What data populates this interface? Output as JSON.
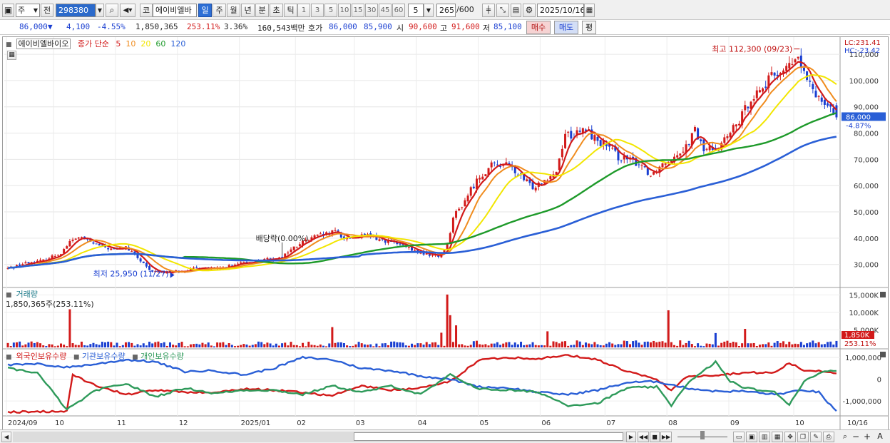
{
  "toolbar": {
    "period_unit": "주",
    "prev_label": "전",
    "stock_code": "298380",
    "market_badge": "코",
    "stock_name": "에이비엘바",
    "periods": [
      "일",
      "주",
      "월",
      "년",
      "분",
      "초",
      "틱"
    ],
    "active_period": "일",
    "intervals": [
      "1",
      "3",
      "5",
      "10",
      "15",
      "30",
      "45",
      "60"
    ],
    "interval_custom": "5",
    "count_value": "265",
    "count_max": "/600",
    "date_value": "2025/10/16"
  },
  "quote": {
    "price": "86,000",
    "change_arrow": "▼",
    "change": "4,100",
    "change_pct": "-4.55%",
    "volume": "1,850,365",
    "volume_ratio": "253.11%",
    "turnover": "3.36%",
    "amount": "160,543백만",
    "ask_label": "호가",
    "ask": "86,000",
    "bid": "85,900",
    "open_label": "시",
    "open": "90,600",
    "high_label": "고",
    "high": "91,600",
    "low_label": "저",
    "low": "85,100",
    "buy_label": "매수",
    "sell_label": "매도",
    "avg_label": "평"
  },
  "price_panel": {
    "stock_name": "에이비엘바이오",
    "ma_title": "종가 단순",
    "ma_periods": [
      "5",
      "10",
      "20",
      "60",
      "120"
    ],
    "lc": "LC:231.41",
    "hc": "HC:-23.42",
    "last_price_tag": "86,000",
    "last_pct_tag": "-4.87%",
    "high_note": "최고 112,300 (09/23)",
    "low_note": "최저 25,950 (11/27)",
    "dividend_note": "배당락(0.00%)"
  },
  "volume_panel": {
    "title": "거래량",
    "value_note": "1,850,365주(253.11%)",
    "last_tag": "1,850K",
    "last_pct": "253.11%"
  },
  "holding_panel": {
    "series": [
      "외국인보유수량",
      "기관보유수량",
      "개인보유수량"
    ]
  },
  "xaxis": {
    "labels": [
      "2024/09",
      "10",
      "11",
      "12",
      "2025/01",
      "02",
      "03",
      "04",
      "05",
      "06",
      "07",
      "08",
      "09",
      "10",
      "10/16"
    ]
  },
  "colors": {
    "up": "#d21a1a",
    "down": "#1a3fd1",
    "ma5": "#d21a1a",
    "ma10": "#f08c1e",
    "ma20": "#f2e600",
    "ma60": "#1e9a2a",
    "ma120": "#2a5fd6",
    "foreign": "#d21a1a",
    "institution": "#2a5fd6",
    "individual": "#2e9a5a"
  },
  "chart_data": [
    {
      "type": "candlestick",
      "title": "에이비엘바이오",
      "yticks": [
        30000,
        40000,
        50000,
        60000,
        70000,
        80000,
        90000,
        100000,
        110000
      ],
      "yticklabels": [
        "30,000",
        "40,000",
        "50,000",
        "60,000",
        "70,000",
        "80,000",
        "90,000",
        "100,000",
        "110,000"
      ],
      "ylim": [
        21500,
        116000
      ],
      "grid": true,
      "close_anchors": [
        [
          0,
          28500
        ],
        [
          6,
          30500
        ],
        [
          12,
          31500
        ],
        [
          18,
          34500
        ],
        [
          21,
          38500
        ],
        [
          24,
          40500
        ],
        [
          30,
          37500
        ],
        [
          36,
          35500
        ],
        [
          40,
          36500
        ],
        [
          44,
          32500
        ],
        [
          48,
          27500
        ],
        [
          52,
          27000
        ],
        [
          58,
          27500
        ],
        [
          62,
          28000
        ],
        [
          66,
          29000
        ],
        [
          70,
          28000
        ],
        [
          76,
          29500
        ],
        [
          80,
          30500
        ],
        [
          86,
          31500
        ],
        [
          92,
          32500
        ],
        [
          96,
          35500
        ],
        [
          100,
          38500
        ],
        [
          104,
          40500
        ],
        [
          108,
          41500
        ],
        [
          111,
          42500
        ],
        [
          114,
          40000
        ],
        [
          118,
          40500
        ],
        [
          122,
          41000
        ],
        [
          126,
          39500
        ],
        [
          130,
          38500
        ],
        [
          134,
          37000
        ],
        [
          138,
          35000
        ],
        [
          142,
          34000
        ],
        [
          146,
          33000
        ],
        [
          149,
          37500
        ],
        [
          151,
          48000
        ],
        [
          154,
          52500
        ],
        [
          157,
          58500
        ],
        [
          160,
          63500
        ],
        [
          164,
          67500
        ],
        [
          168,
          68500
        ],
        [
          171,
          66500
        ],
        [
          174,
          63000
        ],
        [
          178,
          59500
        ],
        [
          182,
          62500
        ],
        [
          186,
          65500
        ],
        [
          189,
          80000
        ],
        [
          192,
          79000
        ],
        [
          196,
          81500
        ],
        [
          199,
          78000
        ],
        [
          203,
          75000
        ],
        [
          207,
          71000
        ],
        [
          211,
          69500
        ],
        [
          215,
          68000
        ],
        [
          218,
          64000
        ],
        [
          222,
          68500
        ],
        [
          226,
          71500
        ],
        [
          230,
          75000
        ],
        [
          233,
          81000
        ],
        [
          236,
          73500
        ],
        [
          240,
          74500
        ],
        [
          244,
          78500
        ],
        [
          248,
          84500
        ],
        [
          252,
          93500
        ],
        [
          256,
          97500
        ],
        [
          260,
          102500
        ],
        [
          264,
          104500
        ],
        [
          268,
          108500
        ],
        [
          271,
          99500
        ],
        [
          274,
          95000
        ],
        [
          277,
          92500
        ],
        [
          279,
          90000
        ],
        [
          281,
          86000
        ]
      ],
      "ma_periods": [
        5,
        10,
        20,
        60,
        120
      ],
      "last_close": 86000,
      "high": {
        "value": 112300,
        "date": "09/23"
      },
      "low": {
        "value": 25950,
        "date": "11/27"
      }
    },
    {
      "type": "bar",
      "title": "거래량",
      "yticks": [
        5000,
        10000,
        15000
      ],
      "yticklabels": [
        "5,000K",
        "10,000K",
        "15,000K"
      ],
      "ylim": [
        0,
        16500
      ],
      "unit": "K shares",
      "last_value": 1850,
      "spikes": [
        {
          "index": 21,
          "value": 10900
        },
        {
          "index": 110,
          "value": 5800
        },
        {
          "index": 147,
          "value": 4200
        },
        {
          "index": 149,
          "value": 15100
        },
        {
          "index": 150,
          "value": 9200
        },
        {
          "index": 152,
          "value": 6300
        },
        {
          "index": 183,
          "value": 4600
        },
        {
          "index": 224,
          "value": 10600
        },
        {
          "index": 240,
          "value": 4100
        },
        {
          "index": 250,
          "value": 5300
        }
      ]
    },
    {
      "type": "line",
      "title": "보유수량",
      "yticks": [
        1000000,
        0,
        -1000000
      ],
      "yticklabels": [
        "1,000,000",
        "0",
        "-1,000,000"
      ],
      "ylim": [
        -1650000,
        1300000
      ],
      "series": [
        {
          "name": "외국인보유수량",
          "points": [
            [
              0,
              -1500000
            ],
            [
              10,
              -1500000
            ],
            [
              20,
              -1450000
            ],
            [
              22,
              200000
            ],
            [
              30,
              -300000
            ],
            [
              40,
              -700000
            ],
            [
              50,
              -500000
            ],
            [
              60,
              -600000
            ],
            [
              70,
              -600000
            ],
            [
              80,
              -450000
            ],
            [
              90,
              -500000
            ],
            [
              100,
              -600000
            ],
            [
              110,
              -750000
            ],
            [
              120,
              -300000
            ],
            [
              130,
              -500000
            ],
            [
              140,
              -400000
            ],
            [
              150,
              -100000
            ],
            [
              160,
              900000
            ],
            [
              170,
              1000000
            ],
            [
              180,
              950000
            ],
            [
              190,
              1100000
            ],
            [
              200,
              900000
            ],
            [
              210,
              350000
            ],
            [
              220,
              0
            ],
            [
              225,
              -500000
            ],
            [
              230,
              100000
            ],
            [
              240,
              200000
            ],
            [
              250,
              300000
            ],
            [
              260,
              300000
            ],
            [
              265,
              750000
            ],
            [
              270,
              400000
            ],
            [
              275,
              400000
            ],
            [
              281,
              300000
            ]
          ]
        },
        {
          "name": "기관보유수량",
          "points": [
            [
              0,
              650000
            ],
            [
              10,
              700000
            ],
            [
              20,
              550000
            ],
            [
              30,
              700000
            ],
            [
              40,
              900000
            ],
            [
              50,
              800000
            ],
            [
              60,
              350000
            ],
            [
              70,
              400000
            ],
            [
              80,
              200000
            ],
            [
              90,
              500000
            ],
            [
              100,
              1000000
            ],
            [
              110,
              900000
            ],
            [
              120,
              500000
            ],
            [
              130,
              400000
            ],
            [
              140,
              150000
            ],
            [
              150,
              0
            ],
            [
              160,
              -350000
            ],
            [
              170,
              -400000
            ],
            [
              180,
              -600000
            ],
            [
              190,
              -700000
            ],
            [
              200,
              -500000
            ],
            [
              210,
              -150000
            ],
            [
              220,
              -100000
            ],
            [
              230,
              -400000
            ],
            [
              240,
              -550000
            ],
            [
              250,
              -550000
            ],
            [
              260,
              -700000
            ],
            [
              270,
              -500000
            ],
            [
              275,
              -600000
            ],
            [
              281,
              -1500000
            ]
          ]
        },
        {
          "name": "개인보유수량",
          "points": [
            [
              0,
              500000
            ],
            [
              10,
              300000
            ],
            [
              20,
              -1400000
            ],
            [
              30,
              -500000
            ],
            [
              40,
              -200000
            ],
            [
              50,
              -800000
            ],
            [
              60,
              -400000
            ],
            [
              70,
              -650000
            ],
            [
              80,
              -500000
            ],
            [
              90,
              -500000
            ],
            [
              100,
              -700000
            ],
            [
              110,
              -300000
            ],
            [
              120,
              -600000
            ],
            [
              130,
              -300000
            ],
            [
              140,
              -700000
            ],
            [
              150,
              200000
            ],
            [
              160,
              -450000
            ],
            [
              170,
              -500000
            ],
            [
              180,
              -600000
            ],
            [
              190,
              -1200000
            ],
            [
              200,
              -1100000
            ],
            [
              210,
              -400000
            ],
            [
              220,
              -350000
            ],
            [
              225,
              -1200000
            ],
            [
              230,
              -250000
            ],
            [
              240,
              800000
            ],
            [
              245,
              -100000
            ],
            [
              250,
              -400000
            ],
            [
              260,
              -600000
            ],
            [
              265,
              -1150000
            ],
            [
              270,
              -100000
            ],
            [
              275,
              300000
            ],
            [
              281,
              400000
            ]
          ]
        }
      ]
    }
  ]
}
